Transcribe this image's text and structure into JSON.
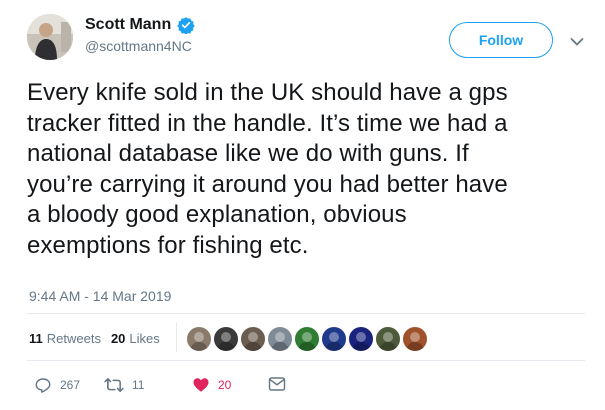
{
  "user": {
    "display_name": "Scott Mann",
    "handle": "@scottmann4NC",
    "verified": true
  },
  "follow_label": "Follow",
  "tweet": {
    "text_lines": [
      "Every knife sold in the UK should have a gps",
      "tracker fitted in the handle. It’s time we had a",
      "national database like we do with guns. If",
      "you’re carrying it around you had better have",
      "a bloody good explanation, obvious",
      "exemptions for fishing etc."
    ],
    "timestamp": "9:44 AM - 14 Mar 2019"
  },
  "stats": {
    "retweets_count": "11",
    "retweets_label": "Retweets",
    "likes_count": "20",
    "likes_label": "Likes"
  },
  "likers": [
    {
      "color": "#8a7a6a"
    },
    {
      "color": "#3a3a3a"
    },
    {
      "color": "#6b5d50"
    },
    {
      "color": "#7e8a94"
    },
    {
      "color": "#2e7d32"
    },
    {
      "color": "#1e3a8a"
    },
    {
      "color": "#1a237e"
    },
    {
      "color": "#4e5b3a"
    },
    {
      "color": "#a0522d"
    }
  ],
  "actions": {
    "reply_count": "267",
    "retweet_count": "11",
    "like_count": "20"
  },
  "colors": {
    "accent": "#1da1f2",
    "like": "#e0245e",
    "muted": "#657786"
  },
  "icons": [
    "verified-badge-icon",
    "chevron-down-icon",
    "reply-icon",
    "retweet-icon",
    "heart-icon",
    "direct-message-icon"
  ]
}
